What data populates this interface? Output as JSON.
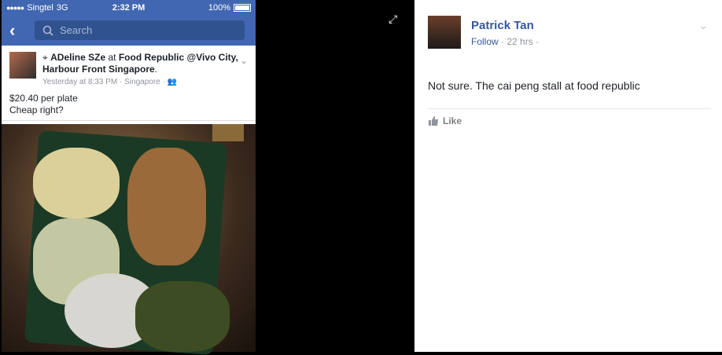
{
  "statusbar": {
    "carrier": "Singtel",
    "network": "3G",
    "time": "2:32 PM",
    "battery": "100%"
  },
  "navbar": {
    "search_placeholder": "Search"
  },
  "post": {
    "author": "ADeline SZe",
    "connector": "at",
    "place": "Food Republic @Vivo City, Harbour Front Singapore",
    "time": "Yesterday at 8:33 PM · Singapore ·",
    "text_line1": "$20.40 per plate",
    "text_line2": "Cheap right?"
  },
  "comment_panel": {
    "author": "Patrick Tan",
    "follow": "Follow",
    "time": "· 22 hrs ·",
    "comment": "Not sure. The cai peng stall at food republic",
    "like_label": "Like"
  },
  "colors": {
    "fb_blue": "#4267b2",
    "name_blue": "#365899"
  }
}
